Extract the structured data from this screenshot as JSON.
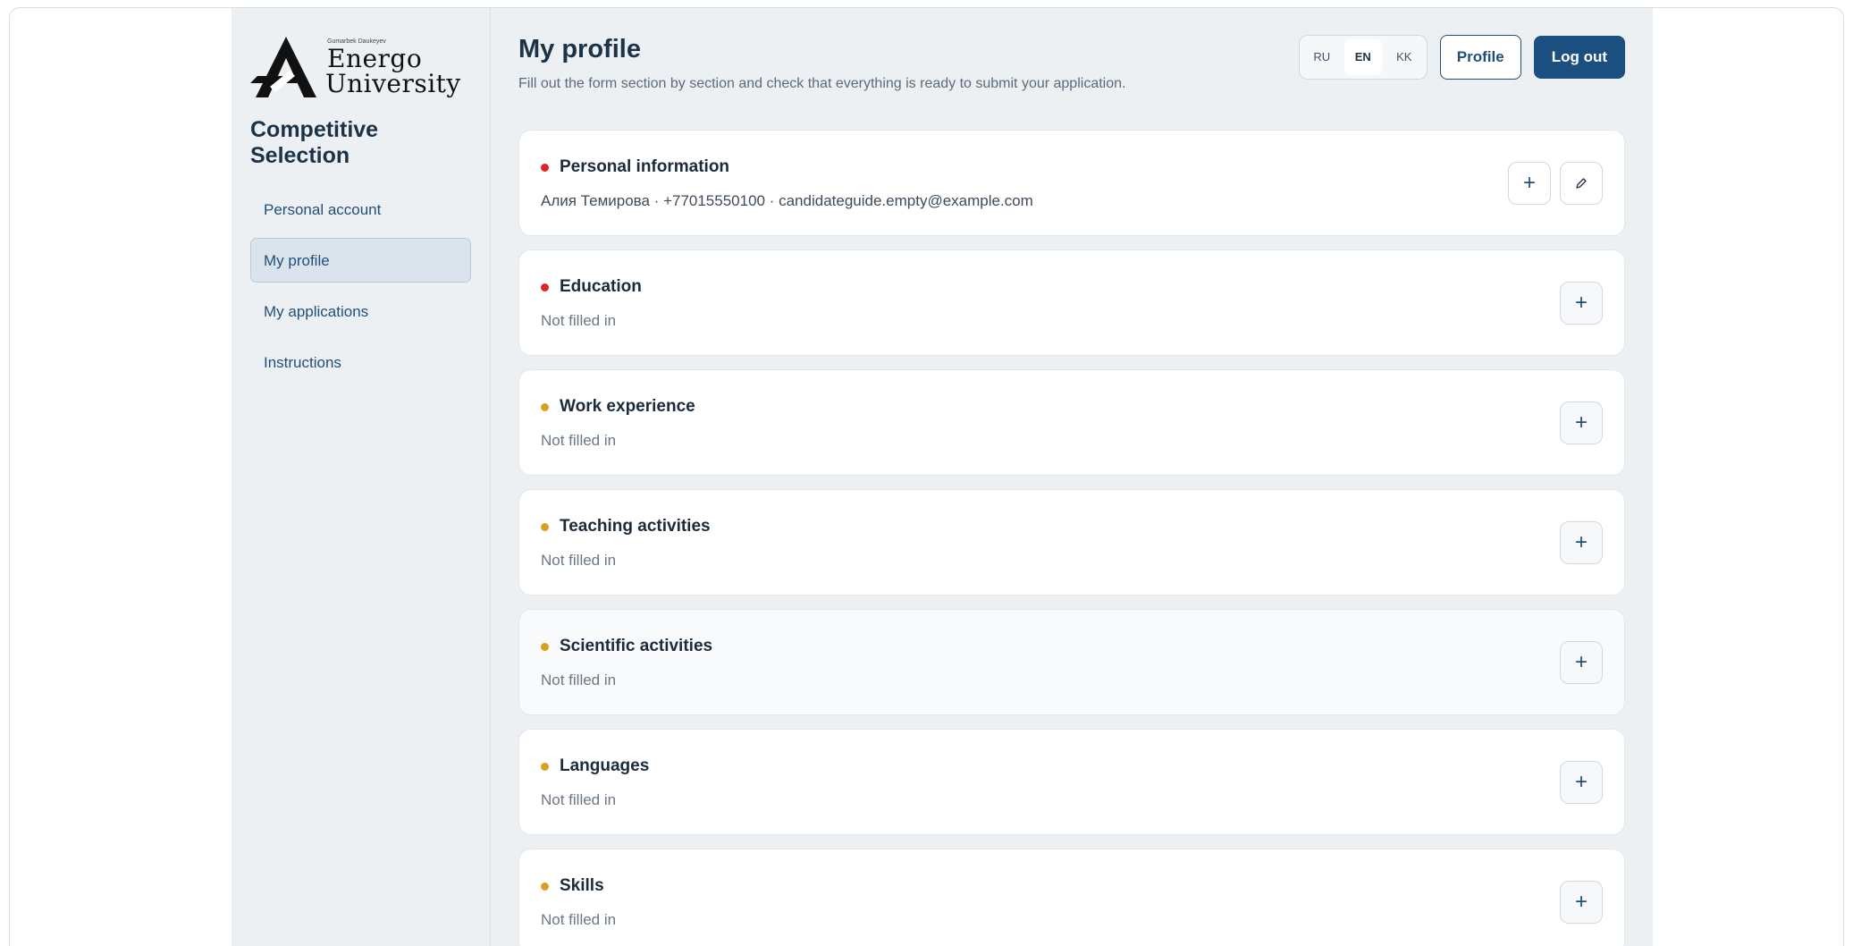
{
  "logo": {
    "small_text": "Gumarbek Daukeyev",
    "line1": "Energo",
    "line2": "University"
  },
  "sidebar": {
    "section_title": "Competitive Selection",
    "items": [
      {
        "label": "Personal account",
        "active": false
      },
      {
        "label": "My profile",
        "active": true
      },
      {
        "label": "My applications",
        "active": false
      },
      {
        "label": "Instructions",
        "active": false
      }
    ]
  },
  "header": {
    "title": "My profile",
    "subtitle": "Fill out the form section by section and check that everything is ready to submit your application.",
    "languages": [
      "RU",
      "EN",
      "KK"
    ],
    "active_language": "EN",
    "profile_label": "Profile",
    "logout_label": "Log out"
  },
  "sections": [
    {
      "title": "Personal information",
      "status": "red",
      "summary": "Алия Темирова · +77015550100 · candidateguide.empty@example.com"
    },
    {
      "title": "Education",
      "status": "red",
      "summary": "Not filled in"
    },
    {
      "title": "Work experience",
      "status": "amber",
      "summary": "Not filled in"
    },
    {
      "title": "Teaching activities",
      "status": "amber",
      "summary": "Not filled in"
    },
    {
      "title": "Scientific activities",
      "status": "amber",
      "summary": "Not filled in"
    },
    {
      "title": "Languages",
      "status": "amber",
      "summary": "Not filled in"
    },
    {
      "title": "Skills",
      "status": "amber",
      "summary": "Not filled in"
    }
  ],
  "icons": {
    "add": "+",
    "edit": "pencil-icon"
  },
  "colors": {
    "primary": "#1a4f7f",
    "status_red": "#dc2626",
    "status_amber": "#d9a01e"
  }
}
